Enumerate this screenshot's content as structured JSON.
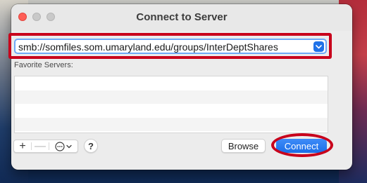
{
  "window": {
    "title": "Connect to Server"
  },
  "address": {
    "value": "smb://somfiles.som.umaryland.edu/groups/InterDeptShares",
    "dropdown_icon": "chevron-down-icon"
  },
  "favorites": {
    "label": "Favorite Servers:",
    "items": []
  },
  "toolbar": {
    "add_label": "+",
    "remove_label": "—",
    "more_icon": "ellipsis-circle-icon",
    "help_label": "?"
  },
  "buttons": {
    "browse_label": "Browse",
    "connect_label": "Connect"
  },
  "colors": {
    "accent": "#1f72e8",
    "annotation": "#c8001b",
    "close": "#ff5f57"
  }
}
